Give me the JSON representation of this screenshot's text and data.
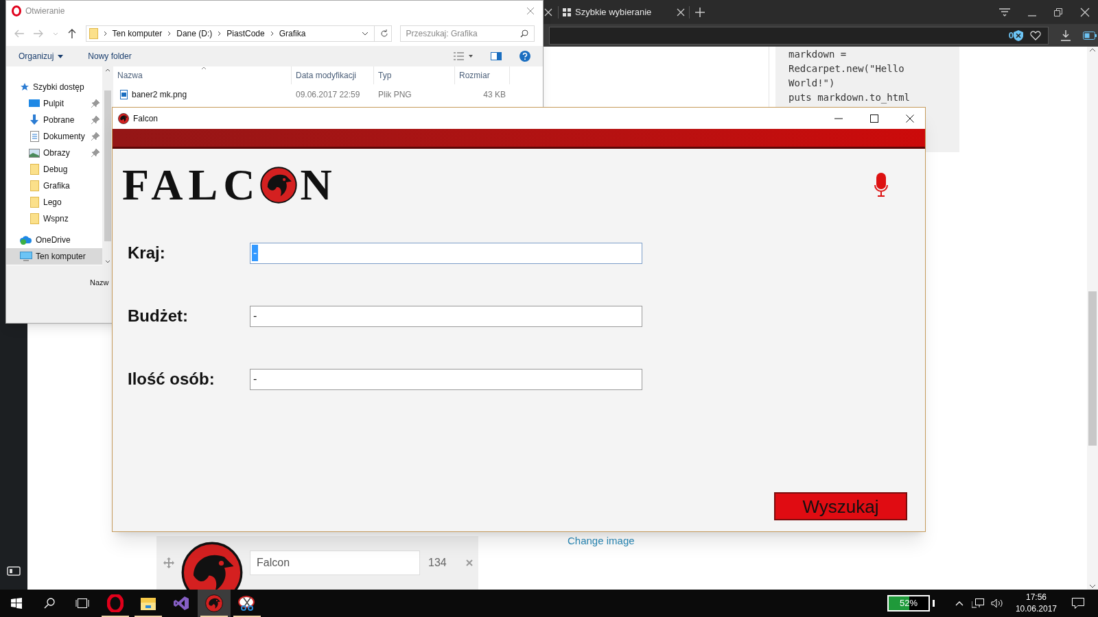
{
  "browser": {
    "tabs": [
      {
        "label": "Szybkie wybieranie",
        "selected": true
      }
    ],
    "blocked_count": "0",
    "code_lines": [
      "markdown =",
      "Redcarpet.new(\"Hello",
      "World!\")",
      "puts markdown.to_html"
    ],
    "image_link": "Change image",
    "image_item": {
      "name": "Falcon",
      "count": "134"
    }
  },
  "file_dialog": {
    "title": "Otwieranie",
    "breadcrumb": [
      "Ten komputer",
      "Dane (D:)",
      "PiastCode",
      "Grafika"
    ],
    "search": {
      "placeholder": "Przeszukaj: Grafika"
    },
    "toolbar": [
      "Organizuj",
      "Nowy folder"
    ],
    "nav": [
      {
        "label": "Szybki dostęp",
        "kind": "star",
        "selected": false,
        "children": [
          {
            "label": "Pulpit",
            "kind": "desktop",
            "pinned": true,
            "selected": false
          },
          {
            "label": "Pobrane",
            "kind": "download",
            "pinned": true,
            "selected": false
          },
          {
            "label": "Dokumenty",
            "kind": "document",
            "pinned": true,
            "selected": false
          },
          {
            "label": "Obrazy",
            "kind": "pictures",
            "pinned": true,
            "selected": false
          },
          {
            "label": "Debug",
            "kind": "folder",
            "pinned": false,
            "selected": false
          },
          {
            "label": "Grafika",
            "kind": "folder",
            "pinned": false,
            "selected": false
          },
          {
            "label": "Lego",
            "kind": "folder",
            "pinned": false,
            "selected": false
          },
          {
            "label": "Wspnz",
            "kind": "folder",
            "pinned": false,
            "selected": false
          }
        ]
      },
      {
        "label": "OneDrive",
        "kind": "cloud",
        "selected": false
      },
      {
        "label": "Ten komputer",
        "kind": "computer",
        "selected": true
      }
    ],
    "columns": [
      "Nazwa",
      "Data modyfikacji",
      "Typ",
      "Rozmiar"
    ],
    "rows": [
      [
        "baner2 mk.png",
        "09.06.2017 22:59",
        "Plik PNG",
        "43 KB"
      ]
    ],
    "filename_label": "Nazw"
  },
  "falcon": {
    "title": "Falcon",
    "logo": {
      "before": "FALC",
      "after": "N"
    },
    "fields": [
      {
        "label": "Kraj:",
        "value": "-",
        "selected": true
      },
      {
        "label": "Budżet:",
        "value": "-",
        "selected": false
      },
      {
        "label": "Ilość osób:",
        "value": "-",
        "selected": false
      }
    ],
    "search_button": "Wyszukaj"
  },
  "taskbar": {
    "apps": [
      {
        "kind": "opera",
        "running": true,
        "active": false
      },
      {
        "kind": "explorer",
        "running": true,
        "active": false
      },
      {
        "kind": "studio",
        "running": false,
        "active": false
      },
      {
        "kind": "falcon",
        "running": true,
        "active": true
      },
      {
        "kind": "snip",
        "running": true,
        "active": false
      }
    ],
    "battery": {
      "reading": "52%",
      "level": 0.52
    },
    "time": "17:56",
    "date": "10.06.2017"
  }
}
